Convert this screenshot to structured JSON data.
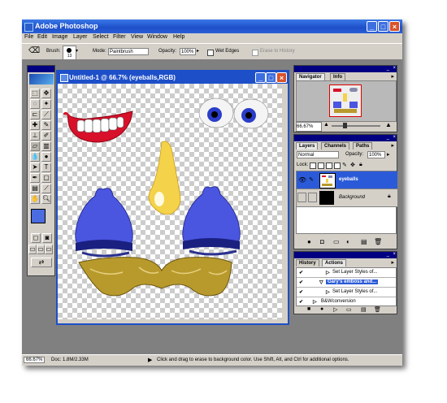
{
  "window": {
    "title": "Adobe Photoshop",
    "min": "_",
    "max": "□",
    "close": "×"
  },
  "menu": [
    "File",
    "Edit",
    "Image",
    "Layer",
    "Select",
    "Filter",
    "View",
    "Window",
    "Help"
  ],
  "options": {
    "brush_label": "Brush:",
    "brush_size": "13",
    "mode_label": "Mode:",
    "mode_value": "Paintbrush",
    "opacity_label": "Opacity:",
    "opacity_value": "100%",
    "wet_edges": "Wet Edges",
    "erase_history": "Erase to History"
  },
  "document": {
    "title": "Untitled-1 @ 66.7% (eyeballs,RGB)"
  },
  "navigator": {
    "tabs": [
      "Navigator",
      "Info"
    ],
    "zoom": "66.67%"
  },
  "layers": {
    "tabs": [
      "Layers",
      "Channels",
      "Paths"
    ],
    "mode": "Normal",
    "opacity_label": "Opacity:",
    "opacity_value": "100%",
    "lock_label": "Lock:",
    "items": [
      {
        "name": "eyeballs",
        "selected": true
      },
      {
        "name": "Background",
        "selected": false
      }
    ]
  },
  "actions": {
    "tabs": [
      "History",
      "Actions"
    ],
    "items": [
      {
        "label": "Set Layer Styles of...",
        "highlight": false
      },
      {
        "label": "Gary's emboss and...",
        "highlight": true
      },
      {
        "label": "Set Layer Styles of...",
        "highlight": false
      },
      {
        "label": "B&Wconversion",
        "highlight": false
      }
    ]
  },
  "status": {
    "zoom": "66.67%",
    "doc": "Doc: 1.8M/2.33M",
    "hint": "Click and drag to erase to background color. Use Shift, Alt, and Ctrl for additional options."
  },
  "colors": {
    "accent": "#1d4fc8",
    "lips": "#d8102a",
    "eyes": "#2a3dc8",
    "nose": "#f4d24a",
    "ears": "#4a55e0",
    "mustache": "#b89a2c"
  }
}
